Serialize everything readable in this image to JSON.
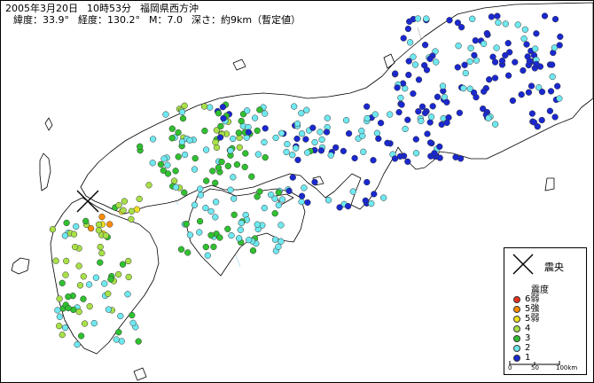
{
  "header": {
    "date": "2005年3月20日",
    "time": "10時53分",
    "region": "福岡県西方沖",
    "latitude": "緯度：33.9°",
    "longitude": "経度：130.2°",
    "magnitude": "M：7.0",
    "depth": "深さ：約9km（暫定値）"
  },
  "legend": {
    "epicenter_label": "震央",
    "title": "震度",
    "items": [
      {
        "label": "6弱",
        "color": "#e8321e"
      },
      {
        "label": "5強",
        "color": "#ff8c00"
      },
      {
        "label": "5弱",
        "color": "#f0e020"
      },
      {
        "label": "4",
        "color": "#a8e048"
      },
      {
        "label": "3",
        "color": "#30c030"
      },
      {
        "label": "2",
        "color": "#6fe8f0"
      },
      {
        "label": "1",
        "color": "#1a28d0"
      }
    ],
    "scale": {
      "zero": "0",
      "mid": "50",
      "max": "100km"
    }
  },
  "colors": {
    "land_fill": "#ffffff",
    "coastline": "#000000",
    "river": "#a8d8ee",
    "prefecture_border": "#b0b0b0",
    "epicenter_marker": "#000000"
  }
}
